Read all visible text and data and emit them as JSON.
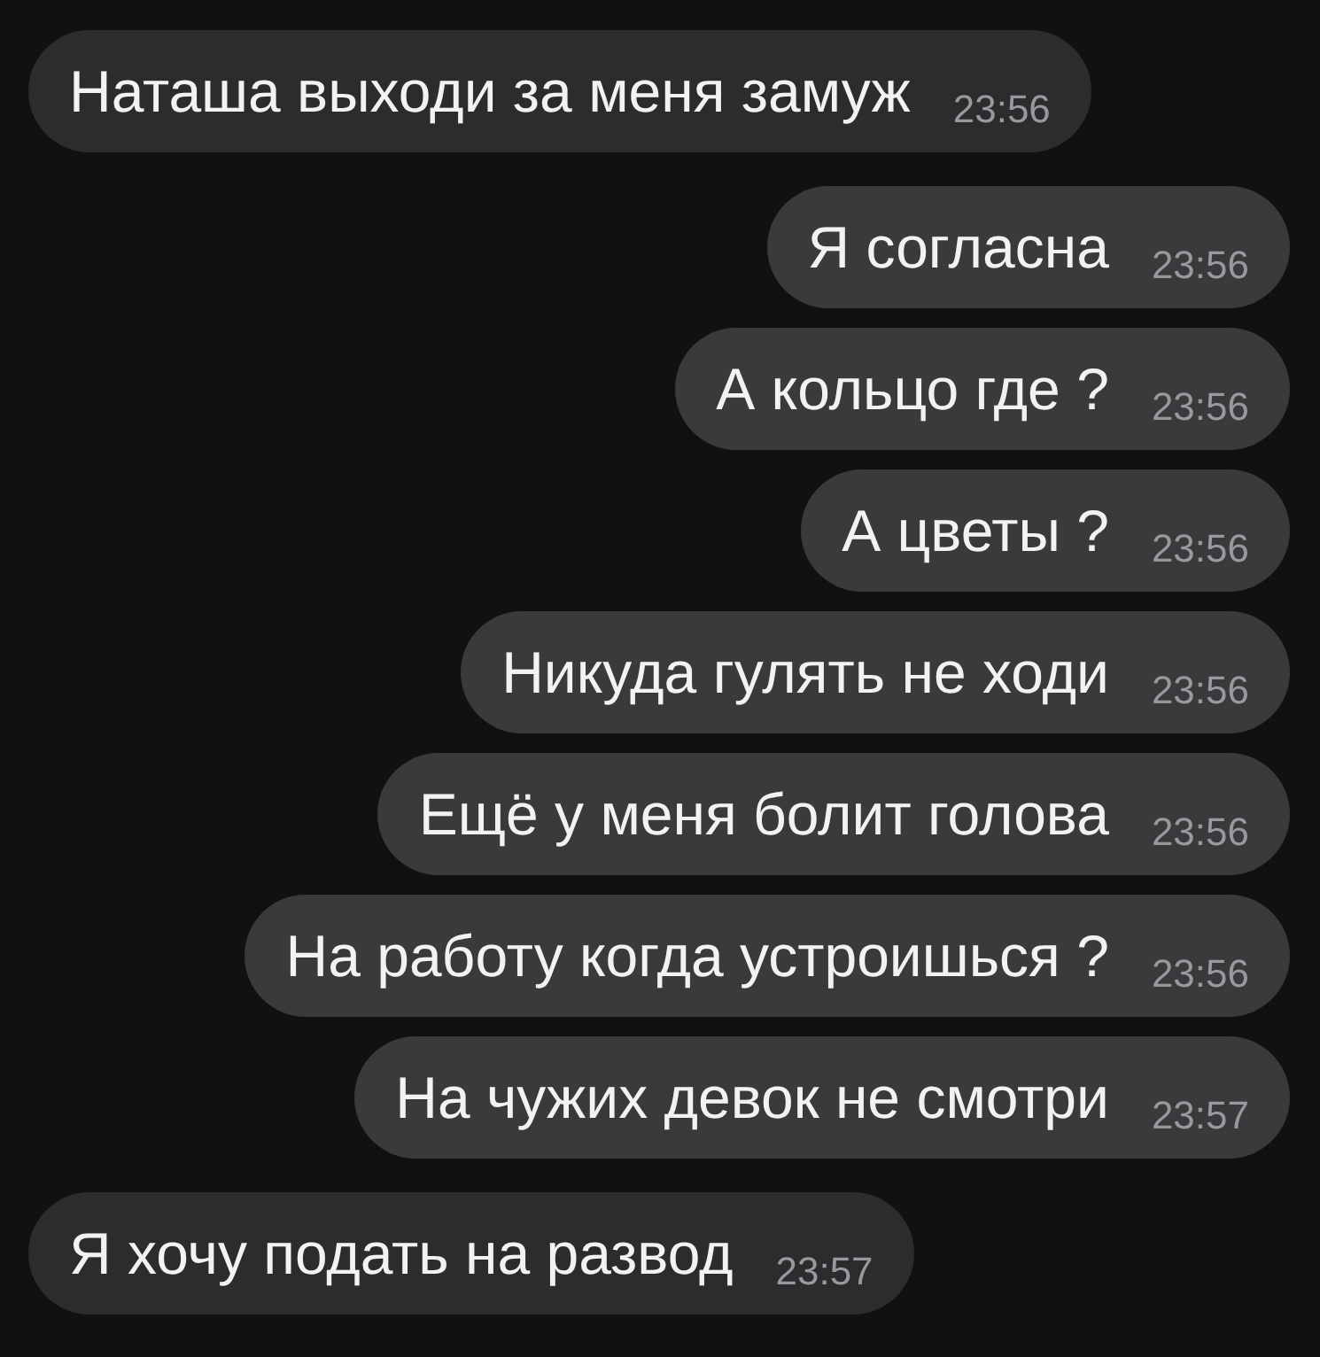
{
  "messages": [
    {
      "kind": "incoming",
      "text": "Наташа выходи за меня замуж",
      "time": "23:56"
    },
    {
      "kind": "outgoing",
      "text": "Я согласна",
      "time": "23:56"
    },
    {
      "kind": "outgoing",
      "text": "А кольцо где ?",
      "time": "23:56"
    },
    {
      "kind": "outgoing",
      "text": "А цветы ?",
      "time": "23:56"
    },
    {
      "kind": "outgoing",
      "text": "Никуда гулять не ходи",
      "time": "23:56"
    },
    {
      "kind": "outgoing",
      "text": "Ещё у меня болит голова",
      "time": "23:56"
    },
    {
      "kind": "outgoing",
      "text": "На работу когда устроишься ?",
      "time": "23:56"
    },
    {
      "kind": "outgoing",
      "text": "На чужих девок не смотри",
      "time": "23:57"
    },
    {
      "kind": "incoming",
      "text": "Я хочу подать на развод",
      "time": "23:57"
    }
  ]
}
